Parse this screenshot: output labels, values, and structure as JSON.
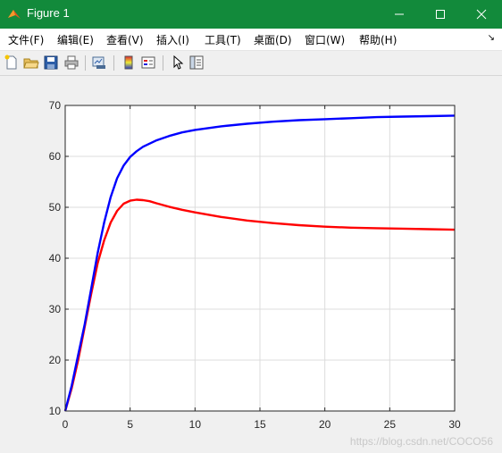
{
  "window": {
    "title": "Figure 1"
  },
  "menu": [
    "文件(F)",
    "编辑(E)",
    "查看(V)",
    "插入(I)",
    "工具(T)",
    "桌面(D)",
    "窗口(W)",
    "帮助(H)"
  ],
  "toolbar": {
    "buttons": [
      "new-figure-icon",
      "open-file-icon",
      "save-icon",
      "print-icon",
      "link-plot-icon",
      "colorbar-icon",
      "legend-icon",
      "pointer-icon",
      "property-inspector-icon"
    ]
  },
  "watermark": "https://blog.csdn.net/COCO56",
  "chart_data": {
    "type": "line",
    "title": "",
    "xlabel": "",
    "ylabel": "",
    "xlim": [
      0,
      30
    ],
    "ylim": [
      10,
      70
    ],
    "xticks": [
      0,
      5,
      10,
      15,
      20,
      25,
      30
    ],
    "yticks": [
      10,
      20,
      30,
      40,
      50,
      60,
      70
    ],
    "grid": true,
    "series": [
      {
        "color": "#0000ff",
        "x": [
          0,
          0.5,
          1,
          1.5,
          2,
          2.5,
          3,
          3.5,
          4,
          4.5,
          5,
          5.5,
          6,
          7,
          8,
          9,
          10,
          12,
          14,
          16,
          18,
          20,
          22,
          24,
          26,
          28,
          30
        ],
        "y": [
          10,
          15,
          21,
          27,
          34,
          41,
          47,
          52,
          55.7,
          58.2,
          59.9,
          61,
          61.9,
          63.1,
          64,
          64.7,
          65.2,
          65.9,
          66.4,
          66.8,
          67.1,
          67.3,
          67.5,
          67.7,
          67.8,
          67.9,
          68
        ]
      },
      {
        "color": "#ff0000",
        "x": [
          0,
          0.5,
          1,
          1.5,
          2,
          2.5,
          3,
          3.5,
          4,
          4.5,
          5,
          5.5,
          6,
          6.5,
          7,
          8,
          9,
          10,
          12,
          14,
          16,
          18,
          20,
          22,
          24,
          26,
          28,
          30
        ],
        "y": [
          10,
          14.5,
          20,
          26.5,
          33,
          39,
          43.5,
          47,
          49.3,
          50.7,
          51.3,
          51.5,
          51.4,
          51.2,
          50.8,
          50.1,
          49.5,
          49,
          48.1,
          47.4,
          46.9,
          46.5,
          46.2,
          46,
          45.9,
          45.8,
          45.7,
          45.6
        ]
      }
    ]
  }
}
